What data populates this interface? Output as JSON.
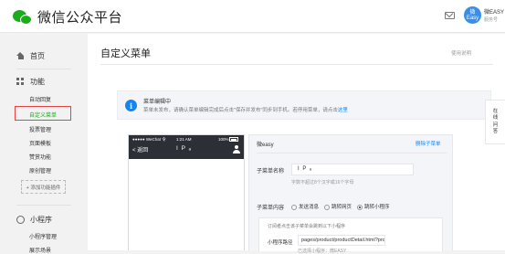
{
  "header": {
    "logo_text": "微信公众平台",
    "avatar_top": "微",
    "avatar_bottom": "Easy",
    "user_name": "微EASY",
    "user_sub": "服务号",
    "mail_icon": "mail-icon"
  },
  "sidebar": {
    "home": "首页",
    "functions": "功能",
    "items": [
      {
        "label": "自动回复"
      },
      {
        "label": "自定义菜单",
        "active": true
      },
      {
        "label": "投票管理"
      },
      {
        "label": "页面模板"
      },
      {
        "label": "赞赏功能"
      },
      {
        "label": "原创管理"
      }
    ],
    "add_plugin": "+ 添加功能插件",
    "miniprogram": "小程序",
    "mini_items": [
      {
        "label": "小程序管理"
      },
      {
        "label": "展示场景"
      }
    ]
  },
  "main": {
    "title": "自定义菜单",
    "help": "使用说明",
    "notice": {
      "title": "菜单编辑中",
      "text": "菜单未发布，请确认菜单编辑完成后点击\"保存并发布\"同步到手机。若停用菜单，请点击",
      "link": "这里"
    },
    "phone": {
      "carrier": "●●●●● WeChat 令",
      "time": "1:21 AM",
      "battery": "100%",
      "back": "< 返回",
      "title": "I P ₐ"
    },
    "editor": {
      "menu_name": "微easy",
      "delete": "删除子菜单",
      "name_label": "子菜单名称",
      "name_value": "I P ₐ",
      "name_hint": "字数不超过8个汉字或16个字母",
      "content_label": "子菜单内容",
      "options": [
        {
          "label": "发送消息",
          "checked": false
        },
        {
          "label": "跳转网页",
          "checked": false
        },
        {
          "label": "跳转小程序",
          "checked": true
        }
      ],
      "sub_desc": "订阅者点击该子菜单会跳到以下小程序",
      "path_label": "小程序路径",
      "path_value": "pages/product/productDetail.html?pro",
      "path_hint": "已选择小程序：微EASY"
    }
  },
  "float_tab": [
    "在",
    "线",
    "问",
    "答"
  ]
}
